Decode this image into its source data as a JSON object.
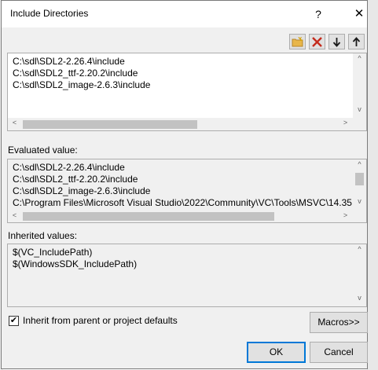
{
  "dialog": {
    "title": "Include Directories",
    "help_label": "?",
    "close_label": "✕"
  },
  "toolbar": {
    "new_line_icon": "new-folder-icon",
    "delete_icon": "delete-icon",
    "move_down_icon": "arrow-down-icon",
    "move_up_icon": "arrow-up-icon",
    "delete_color": "#c42b1c"
  },
  "edit_box": {
    "lines": [
      "C:\\sdl\\SDL2-2.26.4\\include",
      "C:\\sdl\\SDL2_ttf-2.20.2\\include",
      "C:\\sdl\\SDL2_image-2.6.3\\include"
    ]
  },
  "evaluated": {
    "label": "Evaluated value:",
    "lines": [
      "C:\\sdl\\SDL2-2.26.4\\include",
      "C:\\sdl\\SDL2_ttf-2.20.2\\include",
      "C:\\sdl\\SDL2_image-2.6.3\\include",
      "C:\\Program Files\\Microsoft Visual Studio\\2022\\Community\\VC\\Tools\\MSVC\\14.35"
    ]
  },
  "inherited": {
    "label": "Inherited values:",
    "lines": [
      "$(VC_IncludePath)",
      "$(WindowsSDK_IncludePath)"
    ]
  },
  "options": {
    "inherit_label": "Inherit from parent or project defaults",
    "inherit_checked": true,
    "check_glyph": "✔"
  },
  "buttons": {
    "macros": "Macros>>",
    "ok": "OK",
    "cancel": "Cancel"
  },
  "scroll_arrows": {
    "left": "<",
    "right": ">",
    "up": "^",
    "down": "v"
  }
}
